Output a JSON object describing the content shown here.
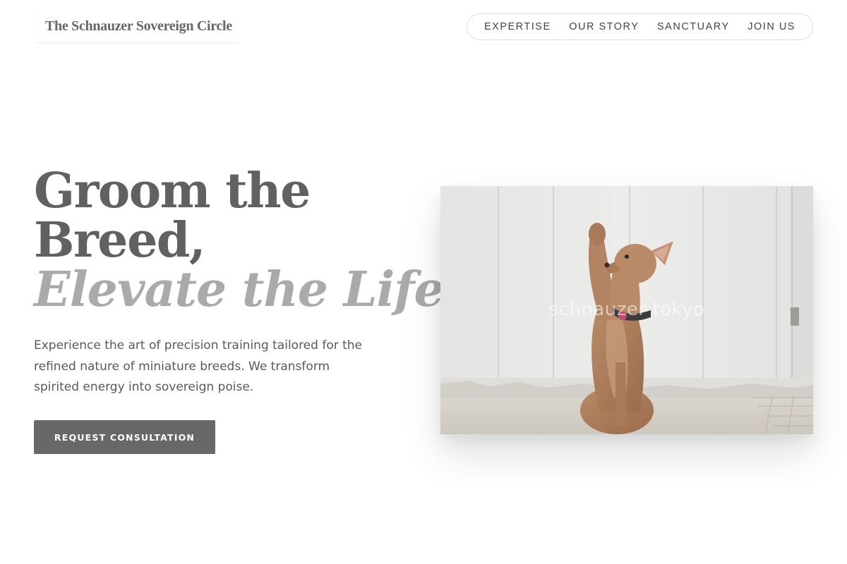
{
  "header": {
    "brand": "The Schnauzer Sovereign Circle",
    "nav": [
      {
        "label": "EXPERTISE"
      },
      {
        "label": "OUR STORY"
      },
      {
        "label": "SANCTUARY"
      },
      {
        "label": "JOIN US"
      }
    ]
  },
  "hero": {
    "title_line1": "Groom the",
    "title_line2": "Breed,",
    "title_line3": "Elevate the Life.",
    "description": "Experience the art of precision training tailored for the refined nature of miniature breeds. We transform spirited energy into sovereign poise.",
    "cta_label": "REQUEST CONSULTATION",
    "image_watermark": "schnauzer tokyo",
    "image_alt": "Tan dog sitting upright raising a paw in front of a white wooden door"
  },
  "colors": {
    "title": "#616161",
    "title_accent": "#aaaaaa",
    "cta_background": "#686868"
  }
}
